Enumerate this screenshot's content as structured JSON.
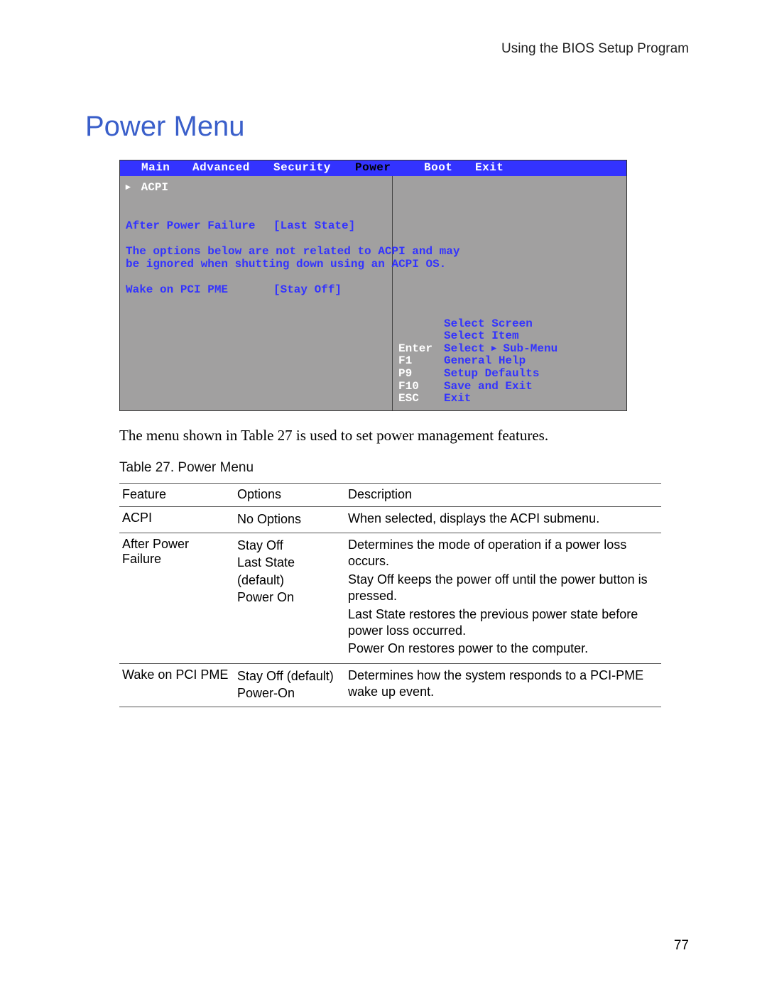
{
  "header": "Using the BIOS Setup Program",
  "title": "Power Menu",
  "page_number": "77",
  "bios": {
    "menubar": {
      "main": "Main",
      "advanced": "Advanced",
      "security": "Security",
      "power": "Power",
      "boot": "Boot",
      "exit": "Exit"
    },
    "left": {
      "acpi": "ACPI",
      "row1_label": "After Power Failure",
      "row1_value": "[Last State]",
      "note_l1": "The options below are not related to ACPI and may",
      "note_l2": "be ignored when shutting down using an ACPI OS.",
      "row2_label": "Wake on PCI PME",
      "row2_value": "[Stay Off]"
    },
    "right": {
      "r0_k": "",
      "r0_v": "Select Screen",
      "r1_k": "",
      "r1_v": "Select Item",
      "r2_k": "Enter",
      "r2_v_pre": "Select ",
      "r2_v_post": " Sub-Menu",
      "r3_k": "F1",
      "r3_v": "General Help",
      "r4_k": "P9",
      "r4_v": "Setup Defaults",
      "r5_k": "F10",
      "r5_v": "Save and Exit",
      "r6_k": "ESC",
      "r6_v": "Exit"
    }
  },
  "paragraph": "The menu shown in Table 27 is used to set power management features.",
  "table": {
    "caption": "Table 27.    Power Menu",
    "head": {
      "c1": "Feature",
      "c2": "Options",
      "c3": "Description"
    },
    "rows": [
      {
        "feature": "ACPI",
        "options": [
          "No Options"
        ],
        "desc": [
          "When selected, displays the ACPI submenu."
        ]
      },
      {
        "feature": "After Power Failure",
        "options": [
          "Stay Off",
          "Last State (default)",
          "Power On"
        ],
        "desc": [
          "Determines the mode of operation if a power loss occurs.",
          "Stay Off keeps the power off until the power button is pressed.",
          "Last State restores the previous power state before power loss occurred.",
          "Power On restores power to the computer."
        ]
      },
      {
        "feature": "Wake on PCI PME",
        "options": [
          "Stay Off (default)",
          "Power-On"
        ],
        "desc": [
          "Determines how the system responds to a PCI-PME wake up event."
        ]
      }
    ]
  }
}
